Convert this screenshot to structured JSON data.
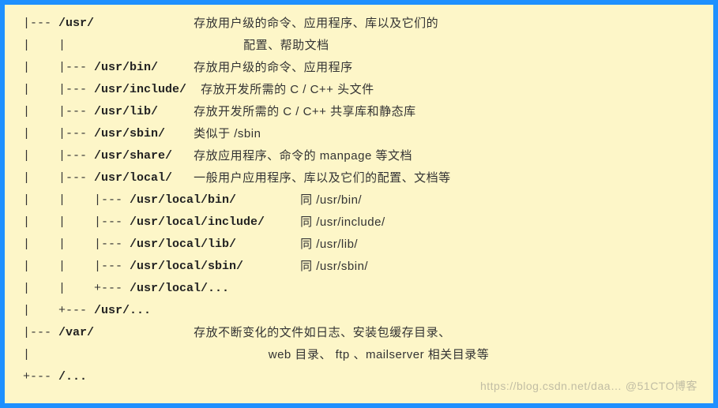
{
  "rows": [
    {
      "tree": " |--- ",
      "path": "/usr/",
      "pad": "              ",
      "desc": "存放用户级的命令、应用程序、库以及它们的"
    },
    {
      "tree": " |    |",
      "path": "",
      "pad": "                         ",
      "desc": "配置、帮助文档"
    },
    {
      "tree": " |    |--- ",
      "path": "/usr/bin/",
      "pad": "     ",
      "desc": "存放用户级的命令、应用程序"
    },
    {
      "tree": " |    |--- ",
      "path": "/usr/include/",
      "pad": "  ",
      "desc": "存放开发所需的 C / C++ 头文件"
    },
    {
      "tree": " |    |--- ",
      "path": "/usr/lib/",
      "pad": "     ",
      "desc": "存放开发所需的 C / C++ 共享库和静态库"
    },
    {
      "tree": " |    |--- ",
      "path": "/usr/sbin/",
      "pad": "    ",
      "desc": "类似于 /sbin"
    },
    {
      "tree": " |    |--- ",
      "path": "/usr/share/",
      "pad": "   ",
      "desc": "存放应用程序、命令的 manpage 等文档"
    },
    {
      "tree": " |    |--- ",
      "path": "/usr/local/",
      "pad": "   ",
      "desc": "一般用户应用程序、库以及它们的配置、文档等"
    },
    {
      "tree": " |    |    |--- ",
      "path": "/usr/local/bin/",
      "pad": "         ",
      "desc": "同 /usr/bin/"
    },
    {
      "tree": " |    |    |--- ",
      "path": "/usr/local/include/",
      "pad": "     ",
      "desc": "同 /usr/include/"
    },
    {
      "tree": " |    |    |--- ",
      "path": "/usr/local/lib/",
      "pad": "         ",
      "desc": "同 /usr/lib/"
    },
    {
      "tree": " |    |    |--- ",
      "path": "/usr/local/sbin/",
      "pad": "        ",
      "desc": "同 /usr/sbin/"
    },
    {
      "tree": " |    |    +--- ",
      "path": "/usr/local/...",
      "pad": "",
      "desc": ""
    },
    {
      "tree": " |    +--- ",
      "path": "/usr/...",
      "pad": "",
      "desc": ""
    },
    {
      "tree": " |--- ",
      "path": "/var/",
      "pad": "              ",
      "desc": "存放不断变化的文件如日志、安装包缓存目录、"
    },
    {
      "tree": " |",
      "path": "",
      "pad": "                                 ",
      "desc": " web 目录、 ftp 、mailserver 相关目录等"
    },
    {
      "tree": " +--- ",
      "path": "/...",
      "pad": "",
      "desc": ""
    }
  ],
  "watermark": "https://blog.csdn.net/daa… @51CTO博客"
}
